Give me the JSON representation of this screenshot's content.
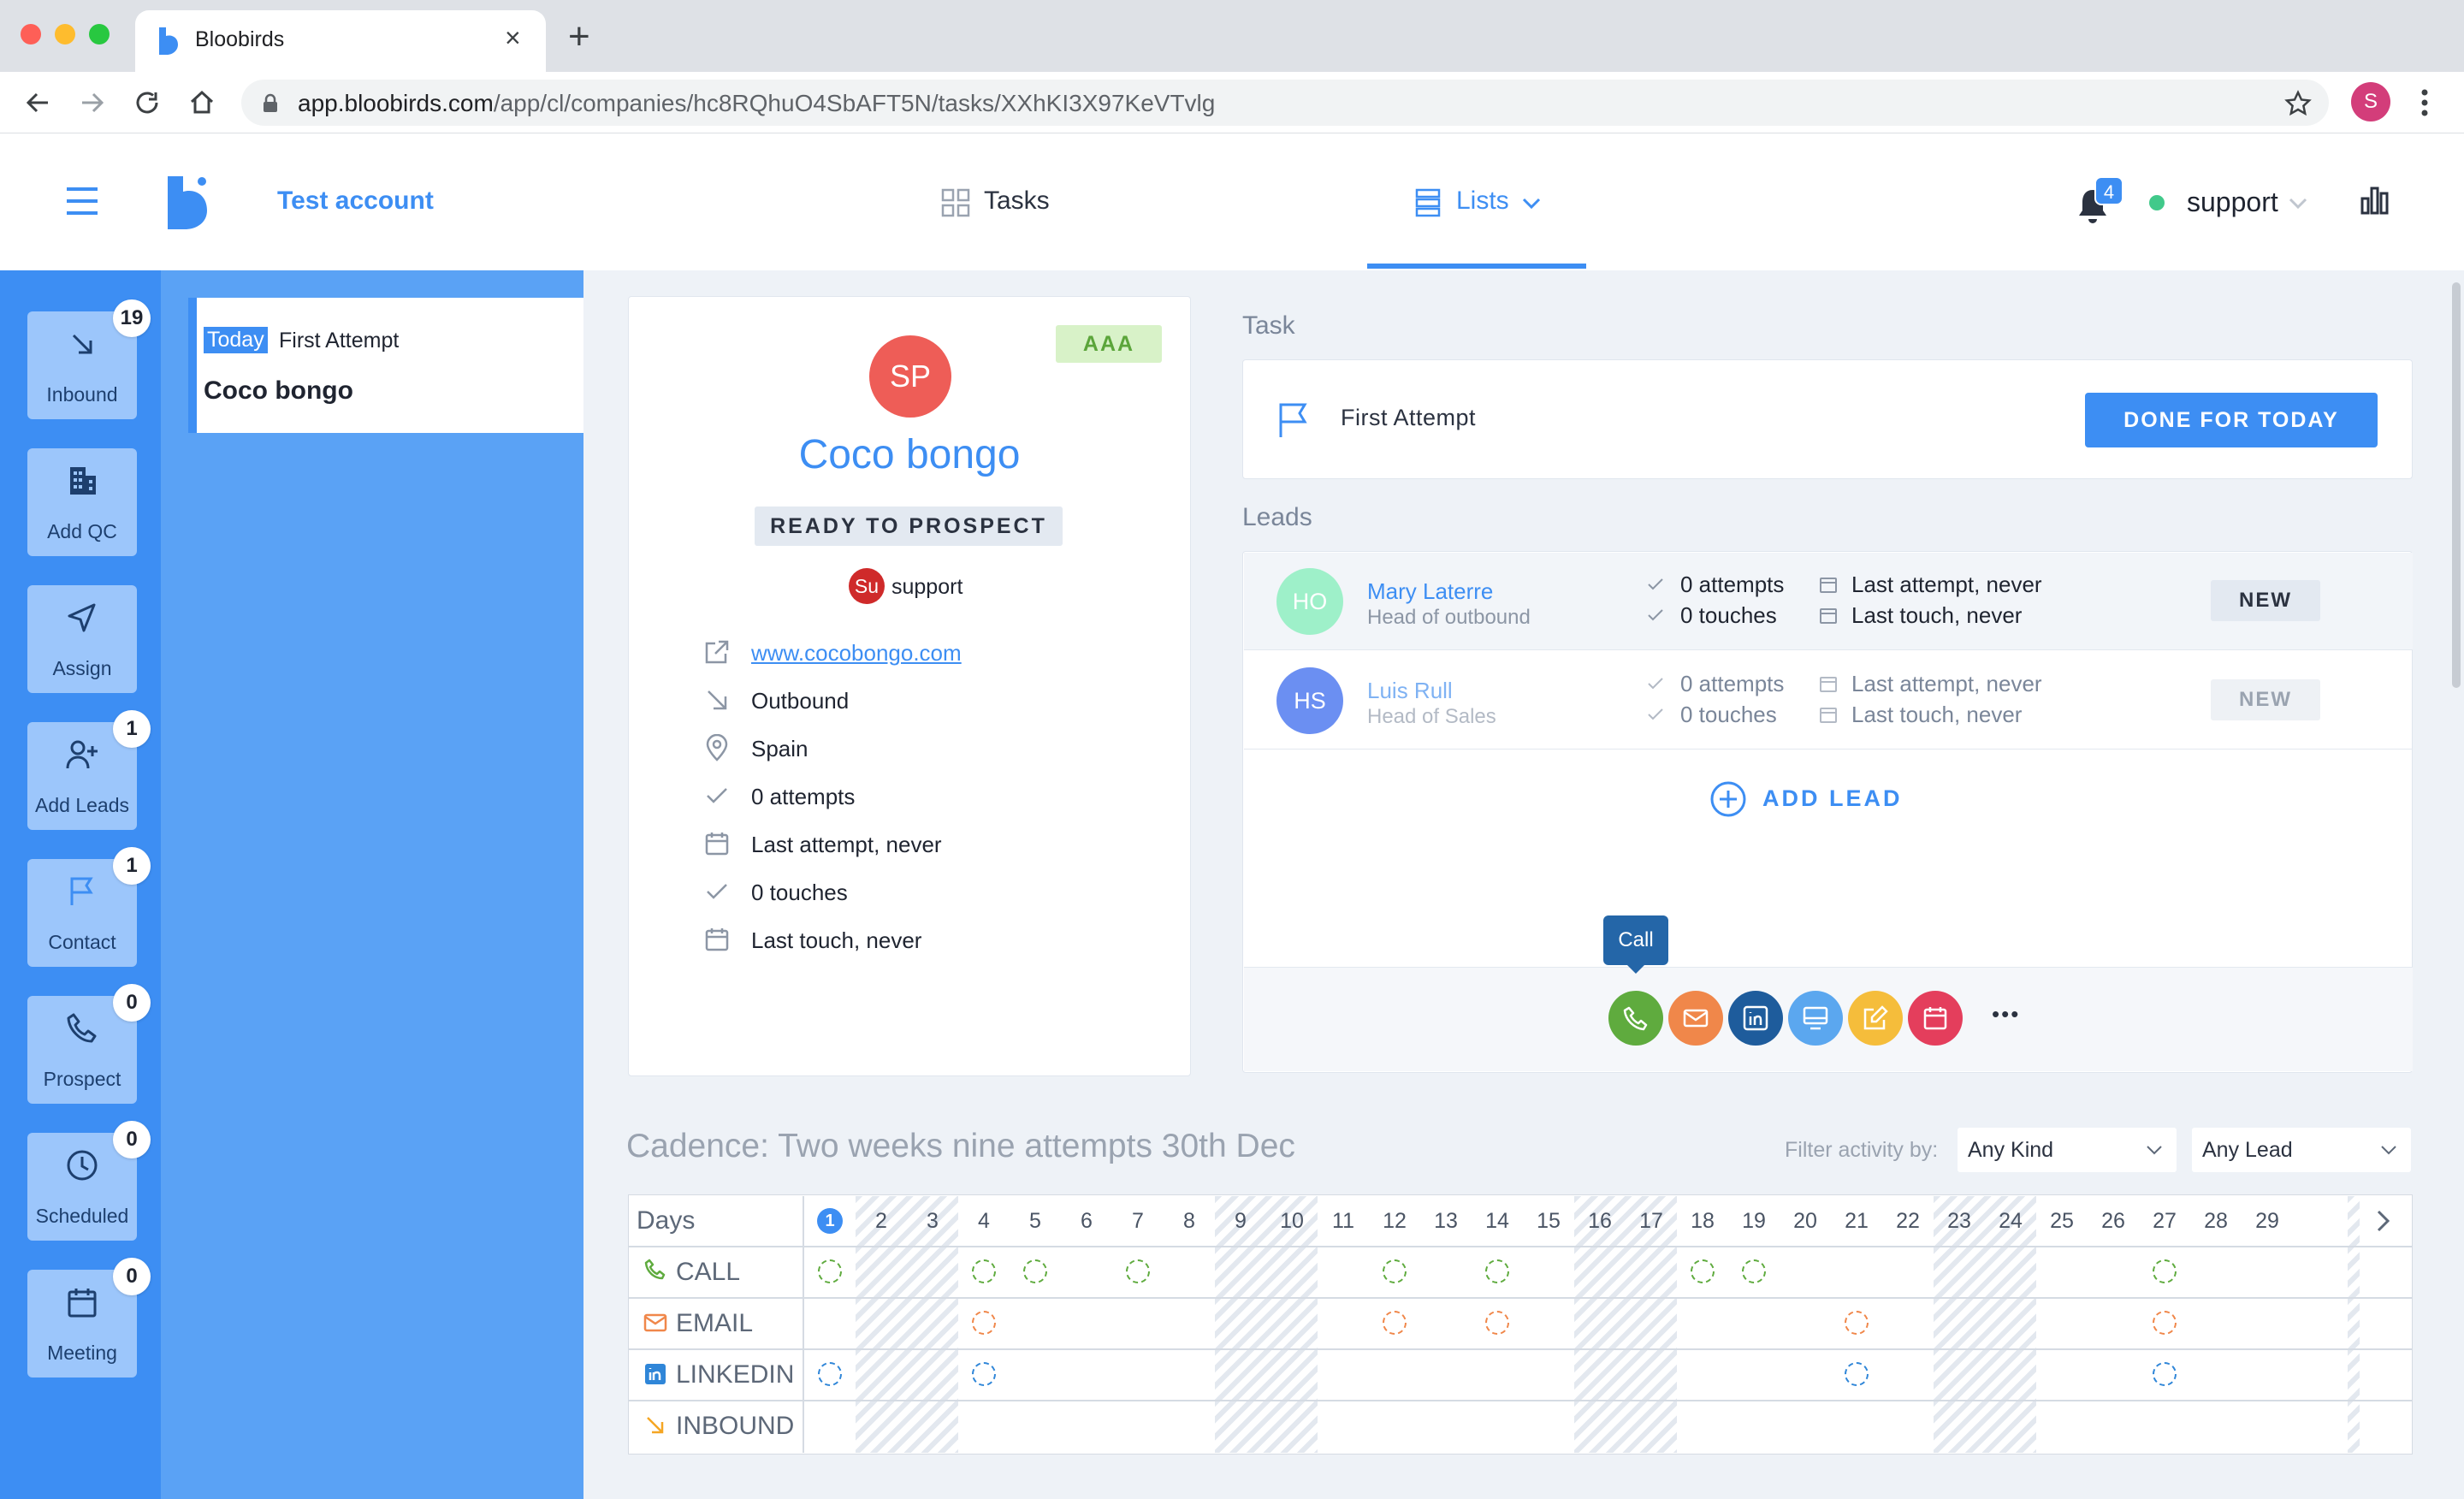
{
  "browser": {
    "tab_title": "Bloobirds",
    "url_domain": "app.bloobirds.com",
    "url_path": "/app/cl/companies/hc8RQhuO4SbAFT5N/tasks/XXhKI3X97KeVTvlg",
    "profile_initial": "S",
    "new_tab": "+",
    "close_tab": "×"
  },
  "header": {
    "account_name": "Test account",
    "nav_tasks": "Tasks",
    "nav_lists": "Lists",
    "notifications_count": "4",
    "user_name": "support"
  },
  "sidebar": [
    {
      "label": "Inbound",
      "count": "19"
    },
    {
      "label": "Add QC",
      "count": ""
    },
    {
      "label": "Assign",
      "count": ""
    },
    {
      "label": "Add Leads",
      "count": "1"
    },
    {
      "label": "Contact",
      "count": "1"
    },
    {
      "label": "Prospect",
      "count": "0"
    },
    {
      "label": "Scheduled",
      "count": "0"
    },
    {
      "label": "Meeting",
      "count": "0"
    }
  ],
  "task_list": {
    "item": {
      "badge": "Today",
      "task": "First Attempt",
      "company": "Coco bongo"
    }
  },
  "company": {
    "initials": "SP",
    "name": "Coco bongo",
    "rating": "AAA",
    "status": "READY TO PROSPECT",
    "owner_initials": "Su",
    "owner_name": "support",
    "website": "www.cocobongo.com",
    "source": "Outbound",
    "country": "Spain",
    "attempts": "0 attempts",
    "last_attempt": "Last attempt, never",
    "touches": "0 touches",
    "last_touch": "Last touch, never"
  },
  "task": {
    "section_title": "Task",
    "name": "First Attempt",
    "done_button": "DONE FOR TODAY"
  },
  "leads": {
    "section_title": "Leads",
    "items": [
      {
        "initials": "HO",
        "name": "Mary Laterre",
        "title": "Head of outbound",
        "attempts": "0 attempts",
        "touches": "0 touches",
        "last_attempt": "Last attempt, never",
        "last_touch": "Last touch, never",
        "status": "NEW"
      },
      {
        "initials": "HS",
        "name": "Luis Rull",
        "title": "Head of Sales",
        "attempts": "0 attempts",
        "touches": "0 touches",
        "last_attempt": "Last attempt, never",
        "last_touch": "Last touch, never",
        "status": "NEW"
      }
    ],
    "add_lead": "ADD LEAD",
    "tooltip": "Call",
    "more": "•••"
  },
  "actions_colors": {
    "call": "#5fab3e",
    "email": "#f0874a",
    "linkedin": "#1e5c9c",
    "meeting": "#5ba7ef",
    "note": "#f5bd3b",
    "calendar": "#e43e5c"
  },
  "cadence": {
    "title": "Cadence: Two weeks nine attempts 30th Dec",
    "filter_label": "Filter activity by:",
    "filter_kind": "Any Kind",
    "filter_lead": "Any Lead",
    "days_label": "Days",
    "days": [
      "1",
      "2",
      "3",
      "4",
      "5",
      "6",
      "7",
      "8",
      "9",
      "10",
      "11",
      "12",
      "13",
      "14",
      "15",
      "16",
      "17",
      "18",
      "19",
      "20",
      "21",
      "22",
      "23",
      "24",
      "25",
      "26",
      "27",
      "28",
      "29"
    ],
    "rows": [
      {
        "label": "CALL",
        "days": [
          1,
          4,
          5,
          7,
          12,
          14,
          18,
          19,
          27
        ],
        "color": "#5fab3e"
      },
      {
        "label": "EMAIL",
        "days": [
          4,
          12,
          14,
          21,
          27
        ],
        "color": "#f0874a"
      },
      {
        "label": "LINKEDIN",
        "days": [
          1,
          4,
          21,
          27
        ],
        "color": "#2f86d8"
      },
      {
        "label": "INBOUND",
        "days": [],
        "color": "#f5a623"
      }
    ]
  }
}
